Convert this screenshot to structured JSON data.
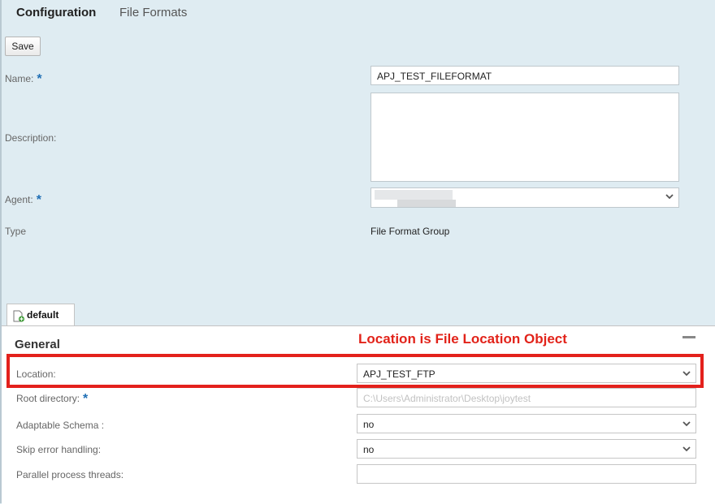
{
  "tabs": {
    "configuration": "Configuration",
    "file_formats": "File Formats"
  },
  "toolbar": {
    "save_label": "Save"
  },
  "form": {
    "name_label": "Name:",
    "name_value": "APJ_TEST_FILEFORMAT",
    "description_label": "Description:",
    "description_value": "",
    "agent_label": "Agent:",
    "type_label": "Type",
    "type_value": "File Format Group",
    "required_mark": "*"
  },
  "subtab": {
    "label": "default"
  },
  "panel": {
    "title": "General",
    "annotation": "Location is File Location Object",
    "location_label": "Location:",
    "location_value": "APJ_TEST_FTP",
    "root_label": "Root directory:",
    "root_placeholder": "C:\\Users\\Administrator\\Desktop\\joytest",
    "adaptable_label": "Adaptable Schema :",
    "adaptable_value": "no",
    "skip_label": "Skip error handling:",
    "skip_value": "no",
    "threads_label": "Parallel process threads:",
    "threads_value": ""
  },
  "colors": {
    "accent_red": "#e3211c",
    "required_blue": "#1f6fb5",
    "background": "#dfecf2"
  }
}
